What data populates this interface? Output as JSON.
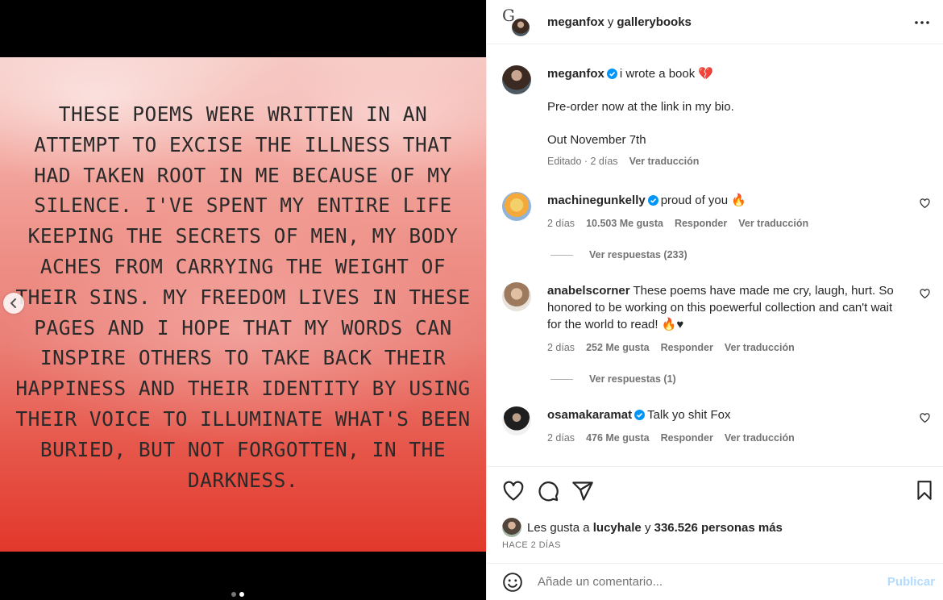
{
  "post": {
    "poem": "These poems were written in an\nattempt to excise the illness that\nhad taken root in me because of my\nsilence. I've spent my entire life\nkeeping the secrets of men, my body\naches from carrying the weight of\ntheir sins. My freedom lives in these\npages and I hope that my words can\ninspire others to take back their\nhappiness and their identity by using\ntheir voice to illuminate what's been\nburied, but not forgotten, in the\ndarkness.",
    "carousel_index": 2,
    "carousel_total": 2
  },
  "header": {
    "user1": "meganfox",
    "joiner": "y",
    "user2": "gallerybooks",
    "logo_letter": "G"
  },
  "caption": {
    "username": "meganfox",
    "text": "i wrote a book 💔",
    "line2": "Pre-order now at the link in my bio.",
    "line3": "Out November 7th",
    "edited": "Editado · 2 días",
    "translate": "Ver traducción"
  },
  "comments": [
    {
      "username": "machinegunkelly",
      "verified": true,
      "text": "proud of you 🔥",
      "time": "2 días",
      "likes": "10.503 Me gusta",
      "reply": "Responder",
      "translate": "Ver traducción",
      "replies_label": "Ver respuestas (233)"
    },
    {
      "username": "anabelscorner",
      "verified": false,
      "text": "These poems have made me cry, laugh, hurt. So honored to be working on this poewerful collection and can't wait for the world to read! 🔥♥",
      "time": "2 días",
      "likes": "252 Me gusta",
      "reply": "Responder",
      "translate": "Ver traducción",
      "replies_label": "Ver respuestas (1)"
    },
    {
      "username": "osamakaramat",
      "verified": true,
      "text": "Talk yo shit Fox",
      "time": "2 días",
      "likes": "476 Me gusta",
      "reply": "Responder",
      "translate": "Ver traducción"
    }
  ],
  "likes": {
    "prefix": "Les gusta a",
    "user": "lucyhale",
    "joiner": "y",
    "others": "336.526 personas más"
  },
  "time_ago": "HACE 2 DÍAS",
  "add_comment": {
    "placeholder": "Añade un comentario...",
    "publish": "Publicar"
  },
  "colors": {
    "verified": "#0095f6",
    "publish_disabled": "#b3dbff",
    "secondary_text": "#737373"
  },
  "icons": [
    "heart-icon",
    "comment-icon",
    "share-icon",
    "bookmark-icon",
    "emoji-icon",
    "more-icon",
    "chevron-left-icon",
    "verified-badge-icon"
  ]
}
